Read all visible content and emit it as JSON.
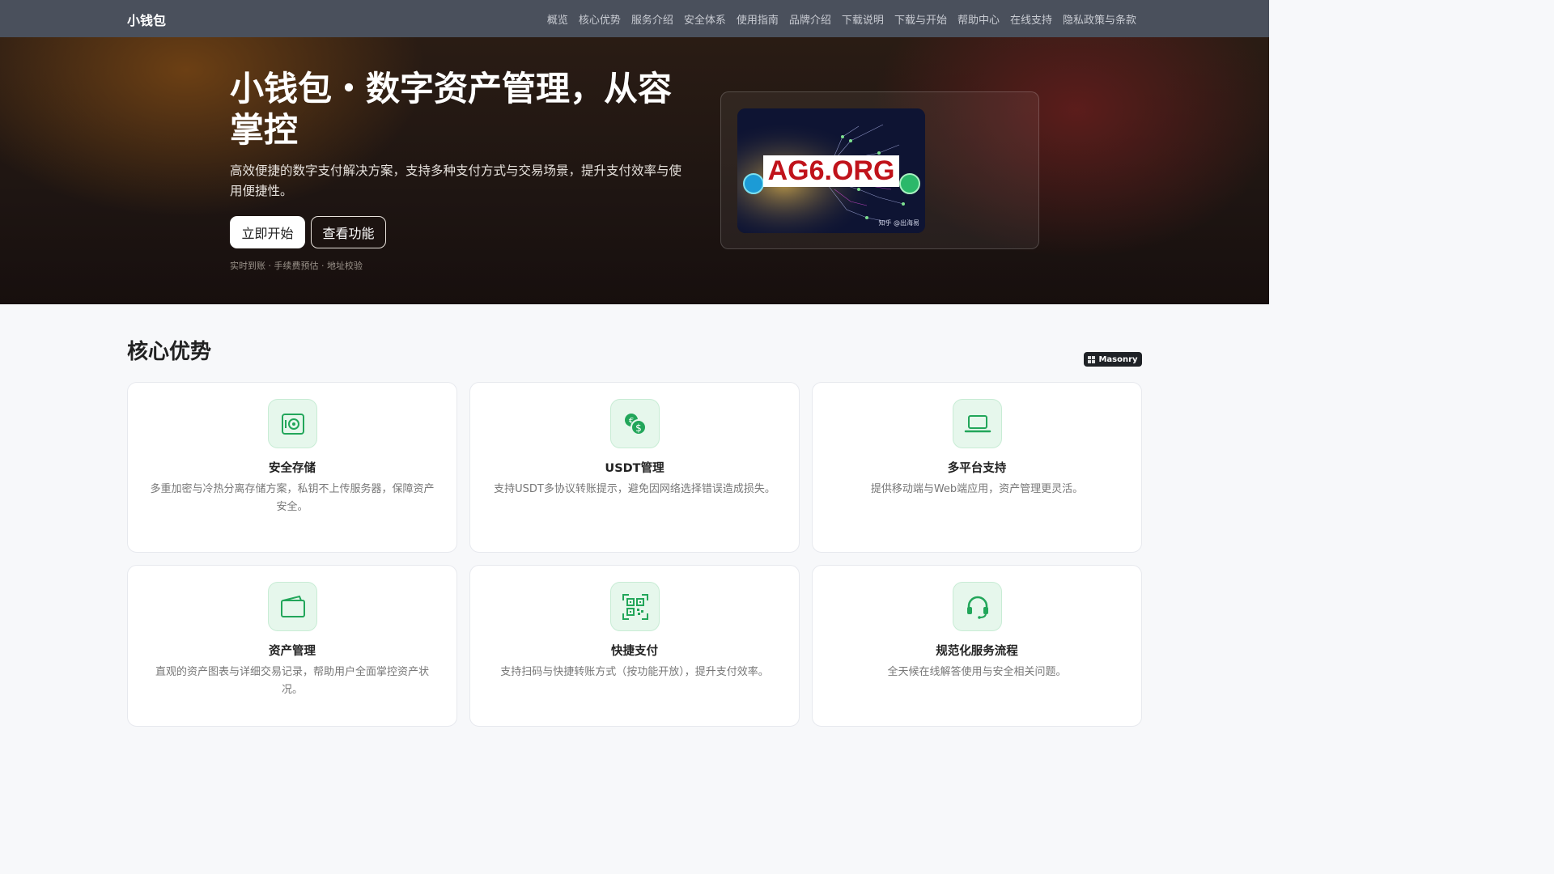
{
  "nav": {
    "brand": "小钱包",
    "links": [
      "概览",
      "核心优势",
      "服务介绍",
      "安全体系",
      "使用指南",
      "品牌介绍",
      "下载说明",
      "下载与开始",
      "帮助中心",
      "在线支持",
      "隐私政策与条款"
    ]
  },
  "hero": {
    "title": "小钱包・数字资产管理，从容掌控",
    "subtitle": "高效便捷的数字支付解决方案，支持多种支付方式与交易场景，提升支付效率与使用便捷性。",
    "primary_button": "立即开始",
    "secondary_button": "查看功能",
    "note": "实时到账 · 手续费预估 · 地址校验",
    "image_banner": "AG6.ORG",
    "image_credit": "知乎 @出海易"
  },
  "features": {
    "title": "核心优势",
    "badge": "Masonry",
    "cards": [
      {
        "title": "安全存储",
        "desc": "多重加密与冷热分离存储方案，私钥不上传服务器，保障资产安全。",
        "icon": "safe-icon"
      },
      {
        "title": "USDT管理",
        "desc": "支持USDT多协议转账提示，避免因网络选择错误造成损失。",
        "icon": "currency-exchange-icon"
      },
      {
        "title": "多平台支持",
        "desc": "提供移动端与Web端应用，资产管理更灵活。",
        "icon": "laptop-icon"
      },
      {
        "title": "资产管理",
        "desc": "直观的资产图表与详细交易记录，帮助用户全面掌控资产状况。",
        "icon": "wallet-icon"
      },
      {
        "title": "快捷支付",
        "desc": "支持扫码与快捷转账方式（按功能开放），提升支付效率。",
        "icon": "qr-scan-icon"
      },
      {
        "title": "规范化服务流程",
        "desc": "全天候在线解答使用与安全相关问题。",
        "icon": "headset-icon"
      }
    ]
  },
  "colors": {
    "accent_green": "#22a65a",
    "nav_bg": "#4a505c",
    "banner_red": "#c0131b"
  }
}
